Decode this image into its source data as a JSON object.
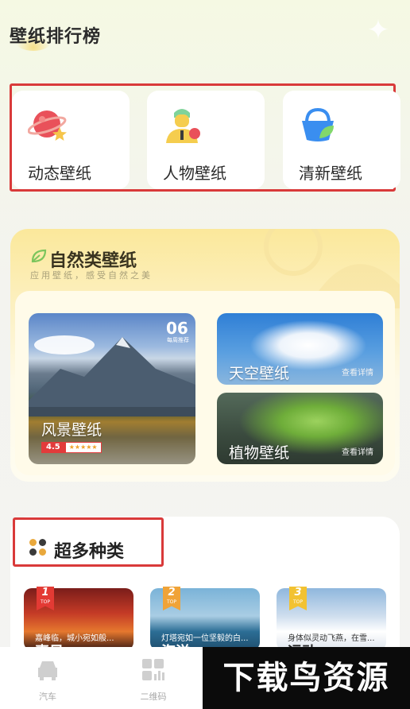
{
  "header": {
    "title": "壁纸排行榜"
  },
  "categories": [
    {
      "label": "动态壁纸",
      "icon": "planet-icon"
    },
    {
      "label": "人物壁纸",
      "icon": "person-icon"
    },
    {
      "label": "清新壁纸",
      "icon": "basket-icon"
    }
  ],
  "nature": {
    "title": "自然类壁纸",
    "subtitle": "应用壁纸，感受自然之美",
    "featured": {
      "label": "风景壁纸",
      "badge_num": "06",
      "badge_sub": "每周推荐",
      "score": "4.5",
      "stars": "★★★★★"
    },
    "cards": [
      {
        "label": "天空壁纸",
        "detail": "查看详情"
      },
      {
        "label": "植物壁纸",
        "detail": "查看详情"
      }
    ]
  },
  "more": {
    "title": "超多种类",
    "items": [
      {
        "rank": "1",
        "top": "TOP",
        "caption": "嘉峰临，城小宛如般...",
        "name": "喜星"
      },
      {
        "rank": "2",
        "top": "TOP",
        "caption": "灯塔宛如一位坚毅的白...",
        "name": "海洋"
      },
      {
        "rank": "3",
        "top": "TOP",
        "caption": "身体似灵动飞燕，在雪...",
        "name": "运动"
      }
    ]
  },
  "tabbar": [
    {
      "label": "汽车",
      "icon": "car-icon"
    },
    {
      "label": "二维码",
      "icon": "grid-chart-icon"
    }
  ],
  "watermark": "下载鸟资源",
  "colors": {
    "accent_red": "#d93a3a",
    "nature_yellow": "#fbe89b"
  }
}
